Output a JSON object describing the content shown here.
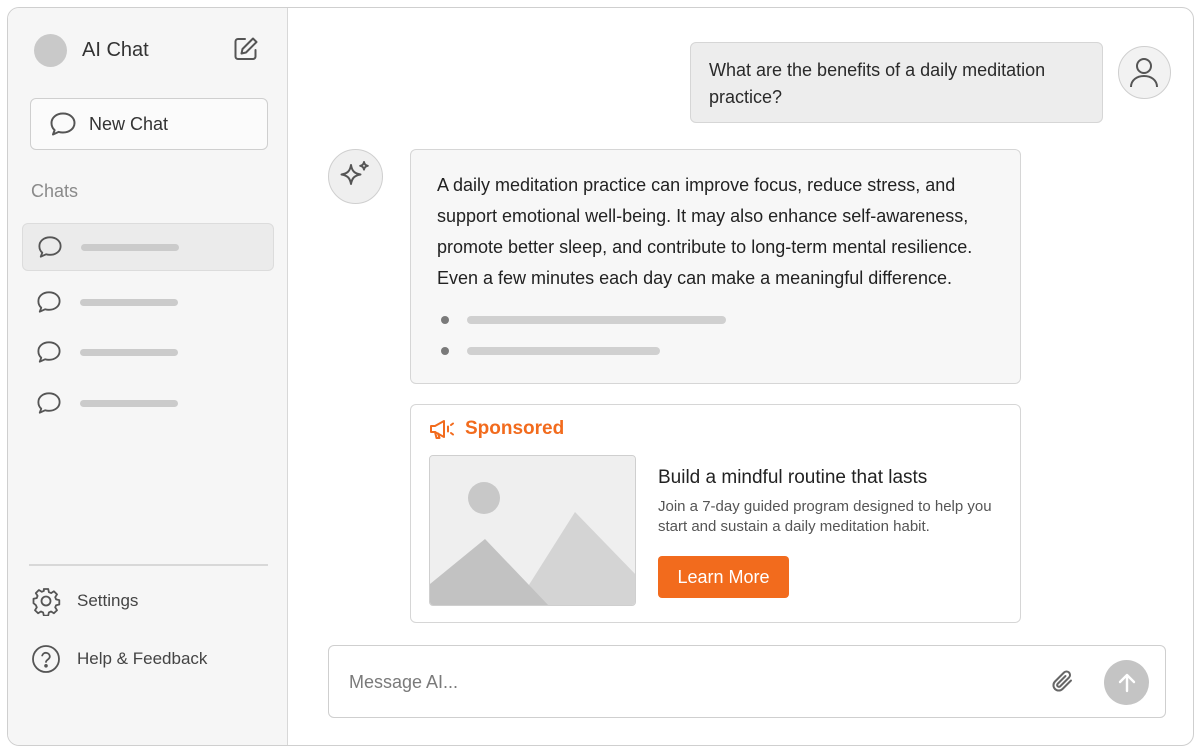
{
  "app": {
    "title": "AI Chat"
  },
  "sidebar": {
    "new_chat_label": "New Chat",
    "chats_heading": "Chats",
    "chat_items": [
      {
        "active": true
      },
      {
        "active": false
      },
      {
        "active": false
      },
      {
        "active": false
      }
    ],
    "settings_label": "Settings",
    "help_label": "Help & Feedback"
  },
  "conversation": {
    "user_message": "What are the benefits of a daily meditation practice?",
    "ai_message": "A daily meditation practice can improve focus, reduce stress, and support emotional well-being. It may also enhance self-awareness, promote better sleep, and contribute to long-term mental resilience. Even a few minutes each day can make a meaningful difference."
  },
  "ad": {
    "label": "Sponsored",
    "title": "Build a mindful routine that lasts",
    "description": "Join a 7-day guided program designed to help you start and sustain a daily meditation habit.",
    "cta_label": "Learn More"
  },
  "composer": {
    "placeholder": "Message AI..."
  },
  "icons": {
    "compose": "compose-icon",
    "chat": "chat-bubble-icon",
    "settings": "gear-icon",
    "help": "help-icon",
    "user": "user-icon",
    "ai": "sparkle-icon",
    "megaphone": "megaphone-icon",
    "attach": "paperclip-icon",
    "send": "arrow-up-icon"
  },
  "colors": {
    "accent": "#f26b1d",
    "sidebar_bg": "#f6f6f6",
    "send_button": "#c4c4c4"
  }
}
